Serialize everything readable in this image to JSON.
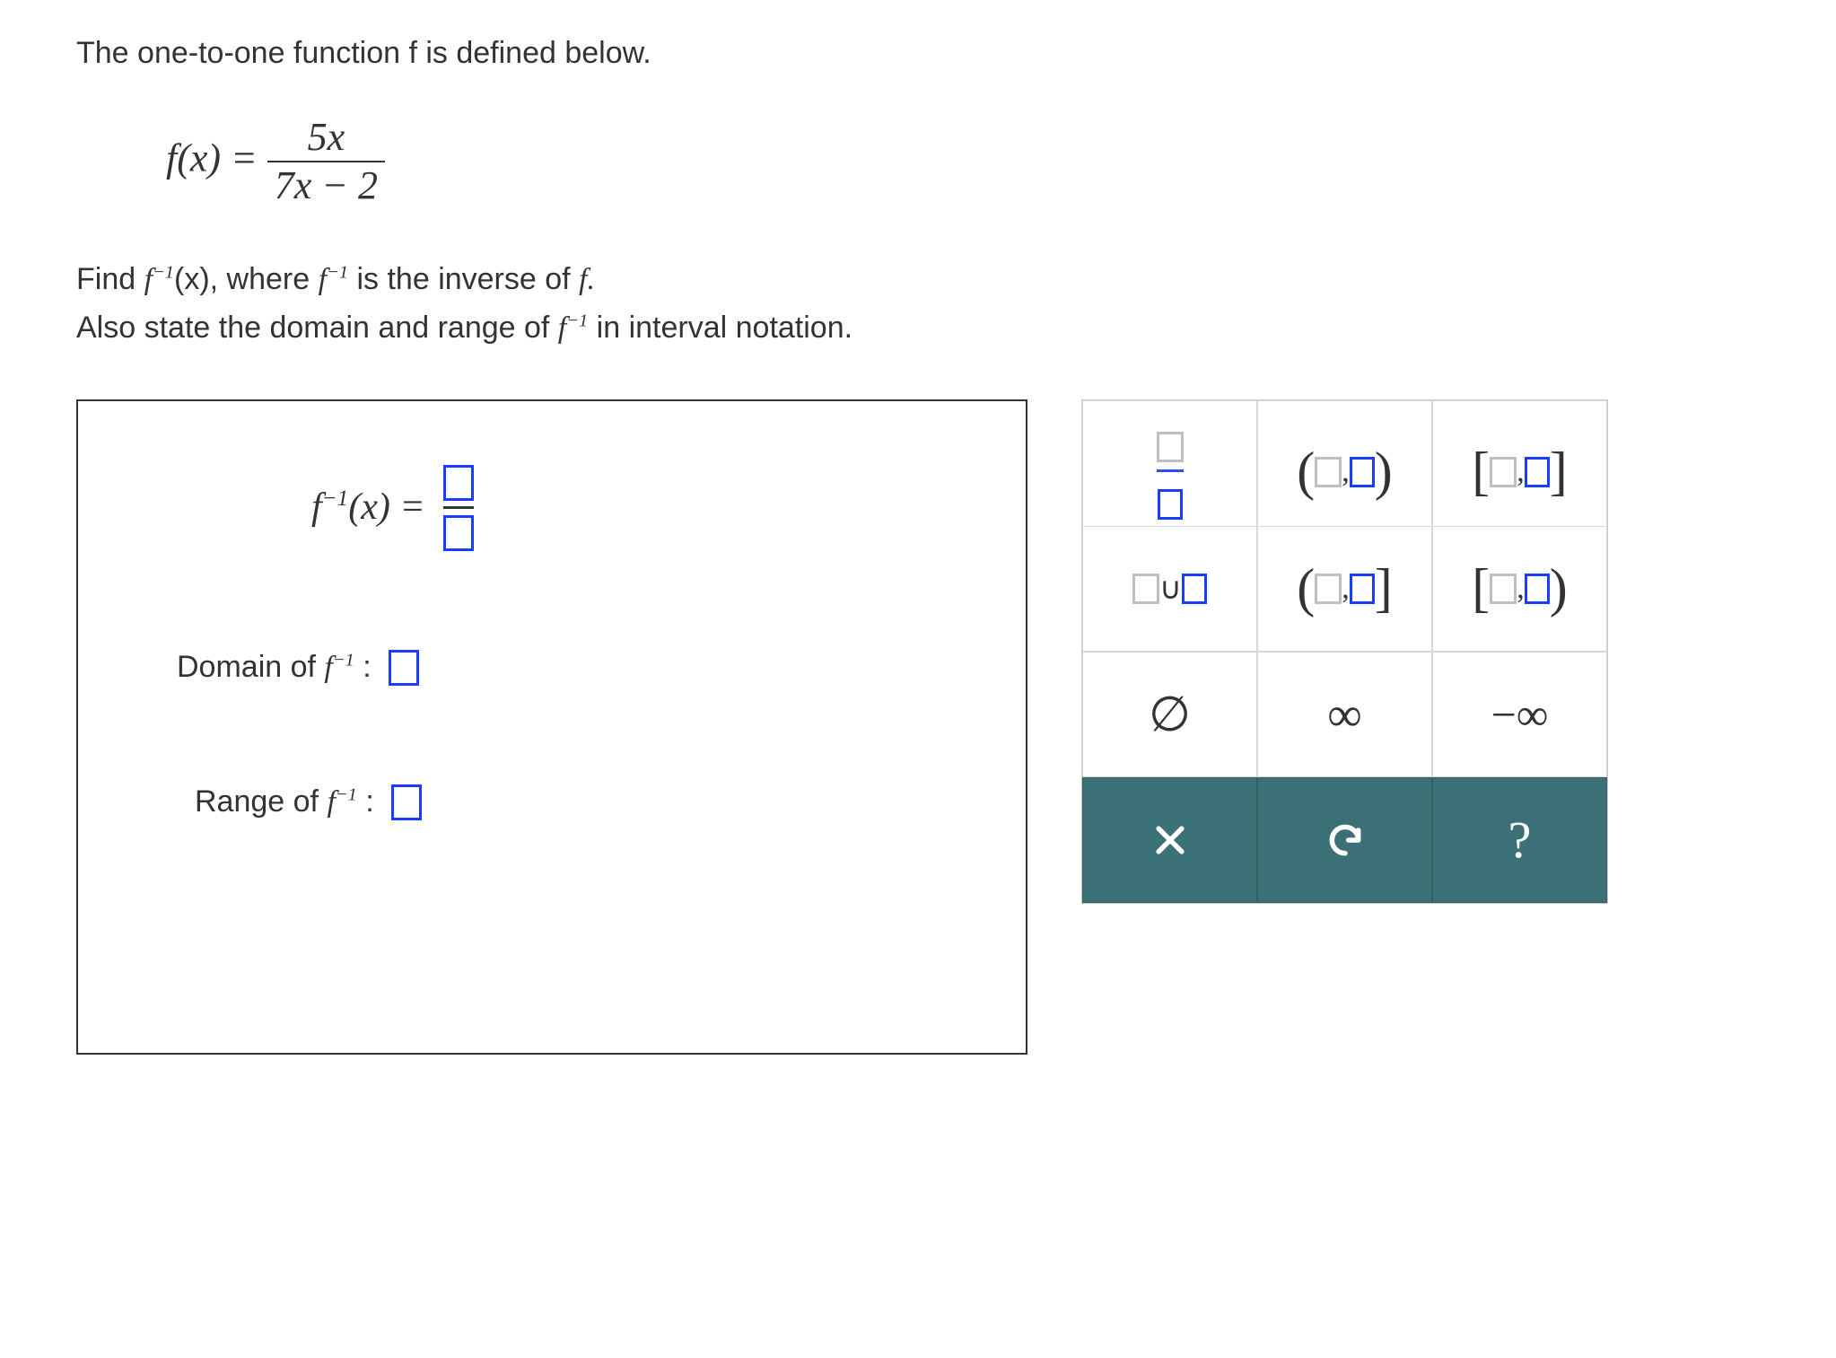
{
  "intro": "The one-to-one function f is defined below.",
  "function": {
    "lhs": "f(x) =",
    "numerator": "5x",
    "denominator": "7x − 2"
  },
  "task_line1_a": "Find ",
  "task_line1_b": "f",
  "task_line1_c": "(x), where ",
  "task_line1_d": "f",
  "task_line1_e": " is the inverse of ",
  "task_line1_f": "f.",
  "task_line2_a": "Also state the domain and range of ",
  "task_line2_b": "f",
  "task_line2_c": " in interval notation.",
  "superscript": "−1",
  "answer": {
    "inverse_label": "f    (x)  =",
    "domain_label": "Domain of ",
    "range_label": "Range of ",
    "f_sup": "−1",
    "colon": " :"
  },
  "palette": {
    "empty_set": "∅",
    "infinity": "∞",
    "neg_infinity": "−∞",
    "union": "∪",
    "clear": "×",
    "undo": "↶",
    "help": "?"
  }
}
